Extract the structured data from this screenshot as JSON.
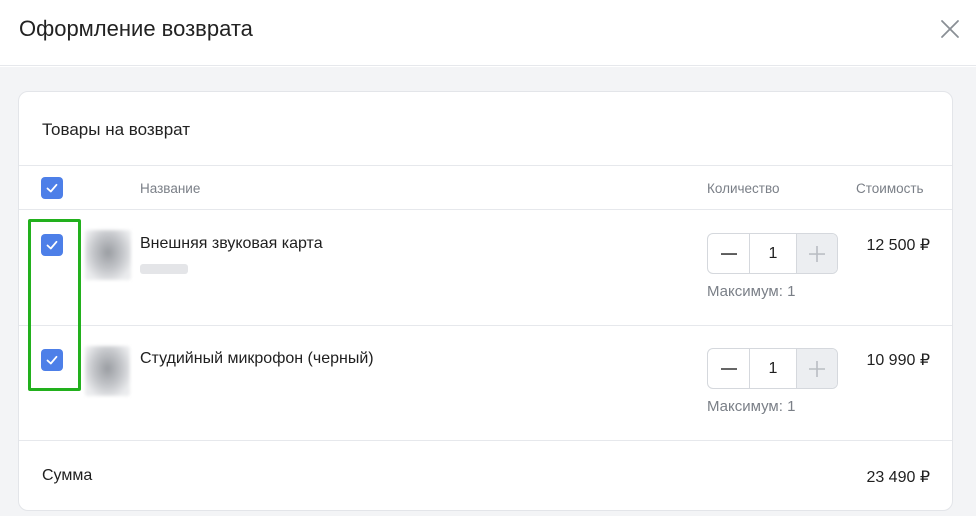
{
  "modal": {
    "title": "Оформление возврата"
  },
  "returns": {
    "section_title": "Товары на возврат",
    "columns": {
      "name": "Название",
      "quantity": "Количество",
      "cost": "Стоимость"
    },
    "items": [
      {
        "name": "Внешняя звуковая карта",
        "quantity": "1",
        "max_label": "Максимум: 1",
        "price": "12 500 ₽",
        "checked": true
      },
      {
        "name": "Студийный микрофон (черный)",
        "quantity": "1",
        "max_label": "Максимум: 1",
        "price": "10 990 ₽",
        "checked": true
      }
    ],
    "total_label": "Сумма",
    "total_value": "23 490 ₽"
  },
  "colors": {
    "accent": "#4d7fe8",
    "highlight": "#22b01d"
  },
  "icons": {
    "close": "close-icon",
    "check": "checkmark-icon",
    "minus": "minus-icon",
    "plus": "plus-icon"
  }
}
